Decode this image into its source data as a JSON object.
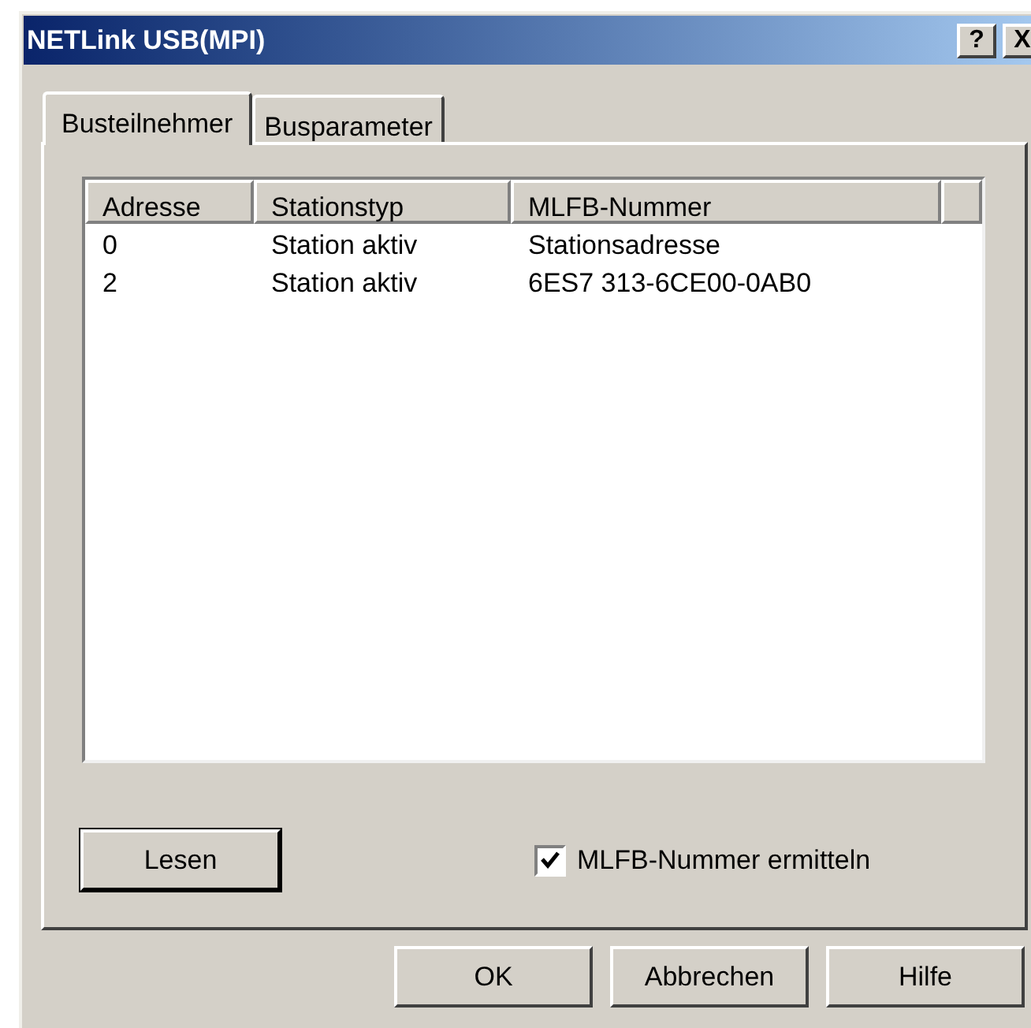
{
  "window": {
    "title": "NETLink USB(MPI)",
    "title_buttons": [
      "?",
      "X"
    ]
  },
  "tabs": [
    {
      "label": "Busteilnehmer",
      "selected": true
    },
    {
      "label": "Busparameter",
      "selected": false
    }
  ],
  "table": {
    "columns": [
      "Adresse",
      "Stationstyp",
      "MLFB-Nummer"
    ],
    "rows": [
      [
        "0",
        "Station aktiv",
        "Stationsadresse"
      ],
      [
        "2",
        "Station aktiv",
        "6ES7 313-6CE00-0AB0"
      ]
    ]
  },
  "read_button": "Lesen",
  "checkbox": {
    "label": "MLFB-Nummer ermitteln",
    "checked": true
  },
  "buttons": [
    "OK",
    "Abbrechen",
    "Hilfe"
  ]
}
